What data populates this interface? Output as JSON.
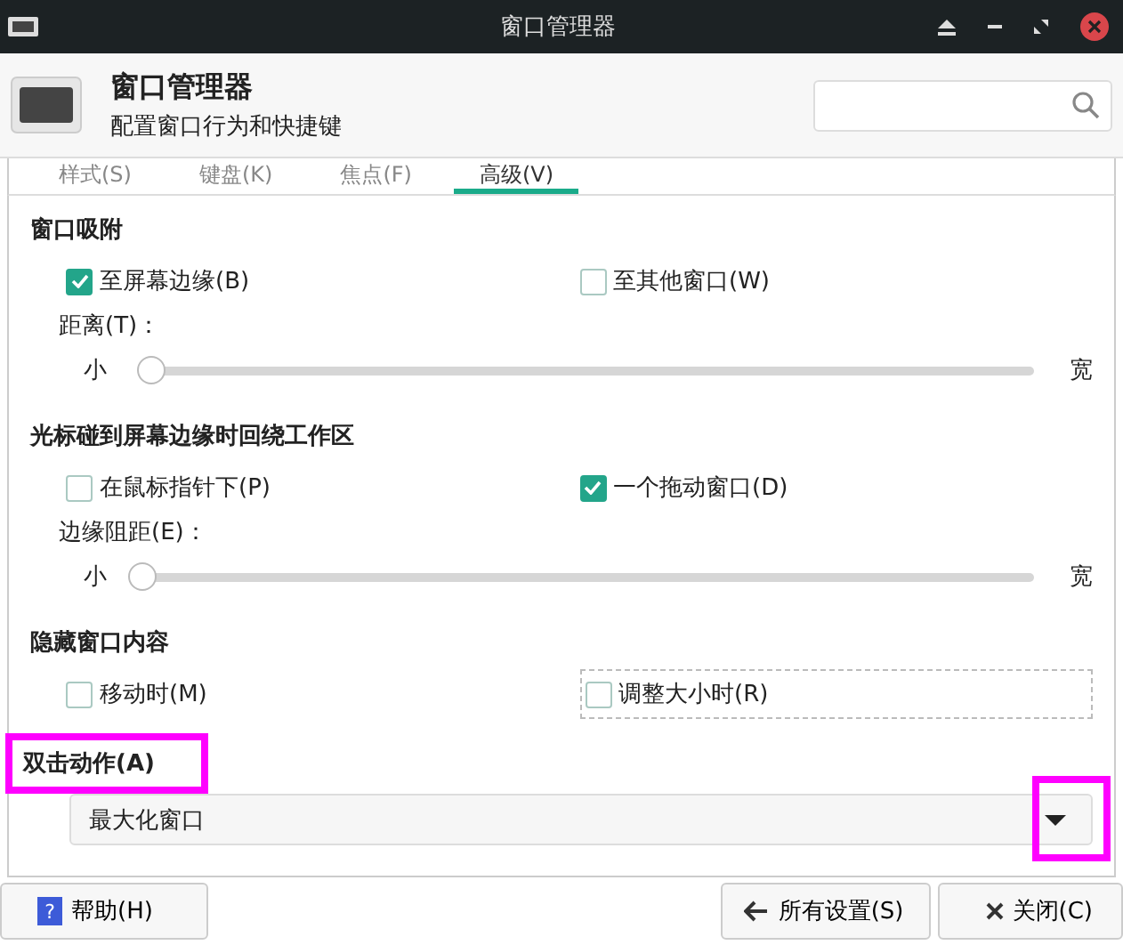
{
  "window": {
    "title": "窗口管理器"
  },
  "header": {
    "title": "窗口管理器",
    "subtitle": "配置窗口行为和快捷键"
  },
  "tabs": [
    {
      "label": "样式(S)",
      "selected": false
    },
    {
      "label": "键盘(K)",
      "selected": false
    },
    {
      "label": "焦点(F)",
      "selected": false
    },
    {
      "label": "高级(V)",
      "selected": true
    }
  ],
  "sections": [
    {
      "title": "窗口吸附",
      "highlighted": false,
      "checkboxes": [
        {
          "label": "至屏幕边缘(B)",
          "checked": true,
          "focused": false
        },
        {
          "label": "至其他窗口(W)",
          "checked": false,
          "focused": false
        }
      ],
      "slider": {
        "label": "距离(T)：",
        "min_label": "小",
        "max_label": "宽",
        "level": 0.01
      }
    },
    {
      "title": "光标碰到屏幕边缘时回绕工作区",
      "highlighted": false,
      "checkboxes": [
        {
          "label": "在鼠标指针下(P)",
          "checked": false,
          "focused": false
        },
        {
          "label": "一个拖动窗口(D)",
          "checked": true,
          "focused": false
        }
      ],
      "slider": {
        "label": "边缘阻距(E)：",
        "min_label": "小",
        "max_label": "宽",
        "level": 0
      }
    },
    {
      "title": "隐藏窗口内容",
      "highlighted": false,
      "checkboxes": [
        {
          "label": "移动时(M)",
          "checked": false,
          "focused": false
        },
        {
          "label": "调整大小时(R)",
          "checked": false,
          "focused": true
        }
      ]
    },
    {
      "title": "双击动作(A)",
      "highlighted": true,
      "dropdown": {
        "value": "最大化窗口",
        "arrow_highlighted": true
      }
    }
  ],
  "buttons": [
    {
      "label": "帮助(H)",
      "kind": "help",
      "icon": "?"
    },
    {
      "label": "所有设置(S)",
      "kind": "back"
    },
    {
      "label": "关闭(C)",
      "kind": "close"
    }
  ]
}
